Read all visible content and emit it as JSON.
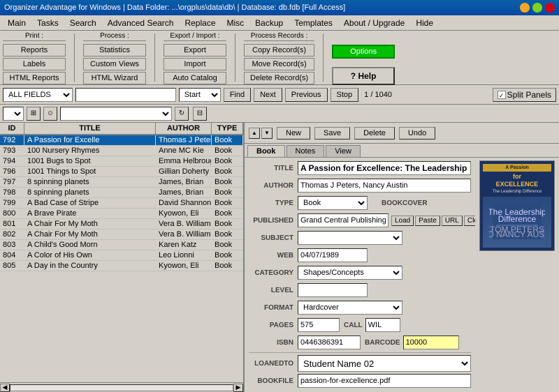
{
  "titlebar": {
    "text": "Organizer Advantage for Windows | Data Folder: ...\\orgplus\\data\\db\\ | Database: db.fdb [Full Access]"
  },
  "menu": {
    "items": [
      "Main",
      "Tasks",
      "Search",
      "Advanced Search",
      "Replace",
      "Misc",
      "Backup",
      "Templates",
      "About / Upgrade",
      "Hide"
    ]
  },
  "toolbar": {
    "print_label": "Print :",
    "reports_btn": "Reports",
    "labels_btn": "Labels",
    "html_reports_btn": "HTML Reports",
    "process_label": "Process :",
    "statistics_btn": "Statistics",
    "custom_views_btn": "Custom Views",
    "html_wizard_btn": "HTML Wizard",
    "export_import_label": "Export / Import :",
    "export_btn": "Export",
    "import_btn": "Import",
    "auto_catalog_btn": "Auto Catalog",
    "process_records_label": "Process Records :",
    "copy_records_btn": "Copy Record(s)",
    "move_records_btn": "Move Record(s)",
    "delete_records_btn": "Delete Record(s)",
    "options_btn": "Options",
    "help_btn": "? Help"
  },
  "searchbar": {
    "field_select": "ALL FIELDS",
    "condition_select": "Start",
    "find_btn": "Find",
    "next_btn": "Next",
    "previous_btn": "Previous",
    "stop_btn": "Stop",
    "page_info": "1 / 1040",
    "split_panels_btn": "Split Panels"
  },
  "table": {
    "headers": [
      "ID",
      "TITLE",
      "AUTHOR",
      "TYPE"
    ],
    "rows": [
      {
        "id": "792",
        "title": "A Passion for Excelle",
        "author": "Thomas J Peters, Na",
        "type": "Book",
        "selected": true
      },
      {
        "id": "793",
        "title": "100 Nursery Rhymes",
        "author": "Anne MC Kie",
        "type": "Book"
      },
      {
        "id": "794",
        "title": "1001 Bugs to Spot",
        "author": "Emma Helbrough",
        "type": "Book"
      },
      {
        "id": "796",
        "title": "1001 Things to Spot",
        "author": "Gillian Doherty",
        "type": "Book"
      },
      {
        "id": "797",
        "title": "8 spinning planets",
        "author": "James, Brian",
        "type": "Book"
      },
      {
        "id": "798",
        "title": "8 spinning planets",
        "author": "James, Brian",
        "type": "Book"
      },
      {
        "id": "799",
        "title": "A Bad Case of Stripe",
        "author": "David Shannon",
        "type": "Book"
      },
      {
        "id": "800",
        "title": "A Brave Pirate",
        "author": "Kyowon, Eli",
        "type": "Book"
      },
      {
        "id": "801",
        "title": "A Chair For My Moth",
        "author": "Vera B. Williams",
        "type": "Book"
      },
      {
        "id": "802",
        "title": "A Chair For My Moth",
        "author": "Vera B. Williams",
        "type": "Book"
      },
      {
        "id": "803",
        "title": "A Child's Good Morn",
        "author": "Karen Katz",
        "type": "Book"
      },
      {
        "id": "804",
        "title": "A Color of His Own",
        "author": "Leo Lionni",
        "type": "Book"
      },
      {
        "id": "805",
        "title": "A Day in the Country",
        "author": "Kyowon, Eli",
        "type": "Book"
      }
    ]
  },
  "detail": {
    "new_btn": "New",
    "save_btn": "Save",
    "delete_btn": "Delete",
    "undo_btn": "Undo",
    "tabs": [
      "Book",
      "Notes",
      "View"
    ],
    "active_tab": "Book",
    "title_label": "TITLE",
    "title_value": "A Passion for Excellence: The Leadership",
    "author_label": "AUTHOR",
    "author_value": "Thomas J Peters, Nancy Austin",
    "type_label": "TYPE",
    "type_value": "Book",
    "bookcover_label": "BOOKCOVER",
    "load_btn": "Load",
    "paste_btn": "Paste",
    "url_btn": "URL",
    "clear_btn": "Clear",
    "published_label": "PUBLISHED",
    "published_value": "Grand Central Publishing",
    "subject_label": "SUBJECT",
    "subject_value": "",
    "web_label": "WEB",
    "web_value": "04/07/1989",
    "category_label": "CATEGORY",
    "category_value": "Shapes/Concepts",
    "level_label": "LEVEL",
    "level_value": "",
    "format_label": "FORMAT",
    "format_value": "Hardcover",
    "pages_label": "PAGES",
    "pages_value": "575",
    "call_label": "CALL",
    "call_value": "WIL",
    "isbn_label": "ISBN",
    "isbn_value": "0446386391",
    "barcode_label": "BARCODE",
    "barcode_value": "10000",
    "loanedto_label": "LOANEDTO",
    "loanedto_value": "Student Name 02",
    "bookfile_label": "BOOKFILE",
    "bookfile_value": "passion-for-excellence.pdf",
    "book_cover_line1": "A Passion",
    "book_cover_line2": "for",
    "book_cover_line3": "EXCELLENCE",
    "book_cover_subtitle": "The Leadership Difference",
    "book_cover_author": "TOM PETERS\nAND NANCY AUSTIN"
  }
}
